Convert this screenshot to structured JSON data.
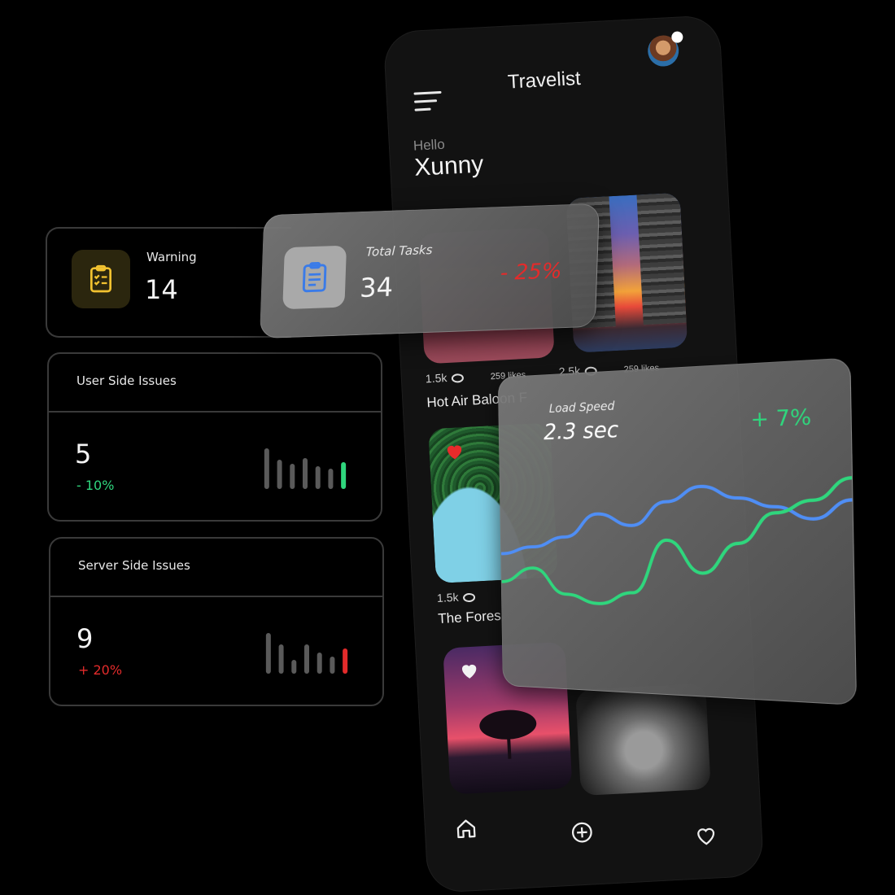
{
  "app": {
    "title": "Travelist",
    "greeting": "Hello",
    "user_name": "Xunny"
  },
  "feed": {
    "items": [
      {
        "views": "1.5k",
        "likes": "259 likes",
        "caption": "Hot Air Baloon F"
      },
      {
        "views": "2.5k",
        "likes": "259 likes",
        "caption": ""
      },
      {
        "views": "1.5k",
        "likes": "",
        "caption": "The Fores"
      }
    ]
  },
  "bottom_nav": [
    "home-icon",
    "add-icon",
    "heart-icon"
  ],
  "warning": {
    "label": "Warning",
    "value": "14"
  },
  "total_tasks": {
    "label": "Total Tasks",
    "value": "34",
    "change": "- 25%"
  },
  "user_issues": {
    "title": "User Side Issues",
    "value": "5",
    "change": "- 10%",
    "change_color": "#2fd67d",
    "bars": [
      1.0,
      0.72,
      0.62,
      0.76,
      0.56,
      0.5,
      0.66
    ],
    "highlight_color": "#2fd67d"
  },
  "server_issues": {
    "title": "Server Side Issues",
    "value": "9",
    "change": "+ 20%",
    "change_color": "#e32b2b",
    "bars": [
      1.0,
      0.72,
      0.34,
      0.72,
      0.52,
      0.42,
      0.62
    ],
    "highlight_color": "#e32b2b"
  },
  "load_speed": {
    "label": "Load Speed",
    "value": "2.3 sec",
    "change": "+ 7%",
    "change_color": "#2fd67d"
  },
  "colors": {
    "accent_blue": "#4f8ef5",
    "accent_green": "#2fd67d",
    "warning_yellow": "#f2c230",
    "danger_red": "#e32b2b"
  },
  "chart_data": {
    "type": "line",
    "title": "",
    "xlabel": "",
    "ylabel": "",
    "x": [
      0,
      1,
      2,
      3,
      4,
      5,
      6,
      7,
      8,
      9,
      10
    ],
    "series": [
      {
        "values": [
          0.5,
          0.55,
          0.62,
          0.78,
          0.7,
          0.86,
          0.96,
          0.88,
          0.82,
          0.74,
          0.86
        ],
        "color": "#4f8ef5"
      },
      {
        "values": [
          0.3,
          0.4,
          0.22,
          0.16,
          0.24,
          0.6,
          0.38,
          0.58,
          0.78,
          0.86,
          1.0
        ],
        "color": "#2fd67d"
      }
    ],
    "ylim": [
      0,
      1.1
    ],
    "grid": false
  }
}
